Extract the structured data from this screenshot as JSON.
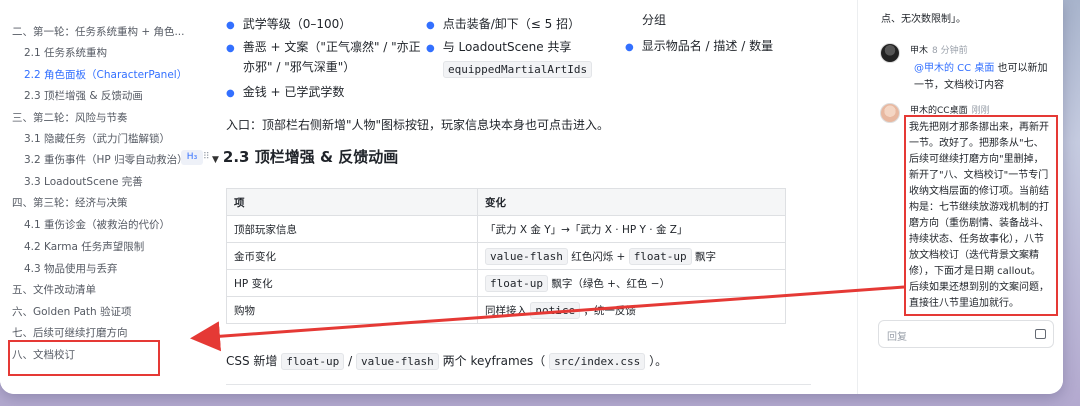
{
  "toc": {
    "items": [
      {
        "label": "二、第一轮：任务系统重构 + 角色...",
        "level": 1,
        "active": false
      },
      {
        "label": "2.1 任务系统重构",
        "level": 2,
        "active": false
      },
      {
        "label": "2.2 角色面板（CharacterPanel）",
        "level": 2,
        "active": true
      },
      {
        "label": "2.3 顶栏增强 & 反馈动画",
        "level": 2,
        "active": false
      },
      {
        "label": "三、第二轮：风险与节奏",
        "level": 1,
        "active": false
      },
      {
        "label": "3.1 隐藏任务（武力门槛解锁）",
        "level": 2,
        "active": false
      },
      {
        "label": "3.2 重伤事件（HP 归零自动救治）",
        "level": 2,
        "active": false
      },
      {
        "label": "3.3 LoadoutScene 完善",
        "level": 2,
        "active": false
      },
      {
        "label": "四、第三轮：经济与决策",
        "level": 1,
        "active": false
      },
      {
        "label": "4.1 重伤诊金（被救治的代价）",
        "level": 2,
        "active": false
      },
      {
        "label": "4.2 Karma 任务声望限制",
        "level": 2,
        "active": false
      },
      {
        "label": "4.3 物品使用与丢弃",
        "level": 2,
        "active": false
      },
      {
        "label": "五、文件改动清单",
        "level": 1,
        "active": false
      },
      {
        "label": "六、Golden Path 验证项",
        "level": 1,
        "active": false
      },
      {
        "label": "七、后续可继续打磨方向",
        "level": 1,
        "active": false
      },
      {
        "label": "八、文档校订",
        "level": 1,
        "active": false
      }
    ],
    "heading_tag": "H₃",
    "drag_handle": "⠿"
  },
  "main": {
    "col1": {
      "item1": "武学等级（0–100）",
      "item2_line1": "善恶 + 文案（\"正气凛然\" / \"亦正",
      "item2_line2": "亦邪\" / \"邪气深重\"）",
      "item3": "金钱 + 已学武学数"
    },
    "col2": {
      "item1": "点击装备/卸下（≤ 5 招）",
      "item2_text": "与 LoadoutScene 共享",
      "item2_code": "equippedMartialArtIds"
    },
    "col3": {
      "overflow_text": "分组",
      "item1": "显示物品名 / 描述 / 数量"
    },
    "entry_paragraph": "入口：顶部栏右侧新增\"人物\"图标按钮，玩家信息块本身也可点击进入。",
    "section_heading": "2.3 顶栏增强 & 反馈动画",
    "section_caret": "▼",
    "table": {
      "headers": [
        "项",
        "变化"
      ],
      "rows": [
        {
          "item": "顶部玩家信息",
          "change_text": "「武力 X 金 Y」→「武力 X · HP Y · 金 Z」"
        },
        {
          "item": "金币变化",
          "code1": "value-flash",
          "mid": "红色闪烁 +",
          "code2": "float-up",
          "tail": "飘字"
        },
        {
          "item": "HP 变化",
          "code1": "float-up",
          "tail": "飘字（绿色 +、红色 −）"
        },
        {
          "item": "购物",
          "prefix": "同样接入",
          "code1": "notice",
          "tail": "，统一反馈"
        }
      ]
    },
    "css_line": {
      "prefix": "CSS 新增",
      "code1": "float-up",
      "sep": "/",
      "code2": "value-flash",
      "mid": "两个 keyframes（",
      "code3": "src/index.css",
      "tail": "）。"
    }
  },
  "comments": {
    "top_fragment": "点、无次数限制」。",
    "comment1": {
      "author": "甲木",
      "time": "8 分钟前",
      "mention": "@甲木的 CC 桌面",
      "line1_rest": "也可以新加",
      "line2": "一节，文档校订内容"
    },
    "comment2": {
      "author": "甲木的CC桌面",
      "time": "刚刚",
      "lines": [
        "我先把刚才那条挪出来，再新开",
        "一节。改好了。把那条从\"七、",
        "后续可继续打磨方向\"里删掉，",
        "新开了\"八、文档校订\"一节专门",
        "收纳文档层面的修订项。当前结",
        "构是：七节继续放游戏机制的打",
        "磨方向（重伤剧情、装备战斗、",
        "持续状态、任务故事化），八节",
        "放文档校订（迭代背景文案精",
        "修），下面才是日期 callout。",
        "后续如果还想到别的文案问题，",
        "直接往八节里追加就行。"
      ]
    },
    "reply_placeholder": "回复"
  },
  "colors": {
    "accent": "#3370ff",
    "annotation_red": "#e53935"
  }
}
